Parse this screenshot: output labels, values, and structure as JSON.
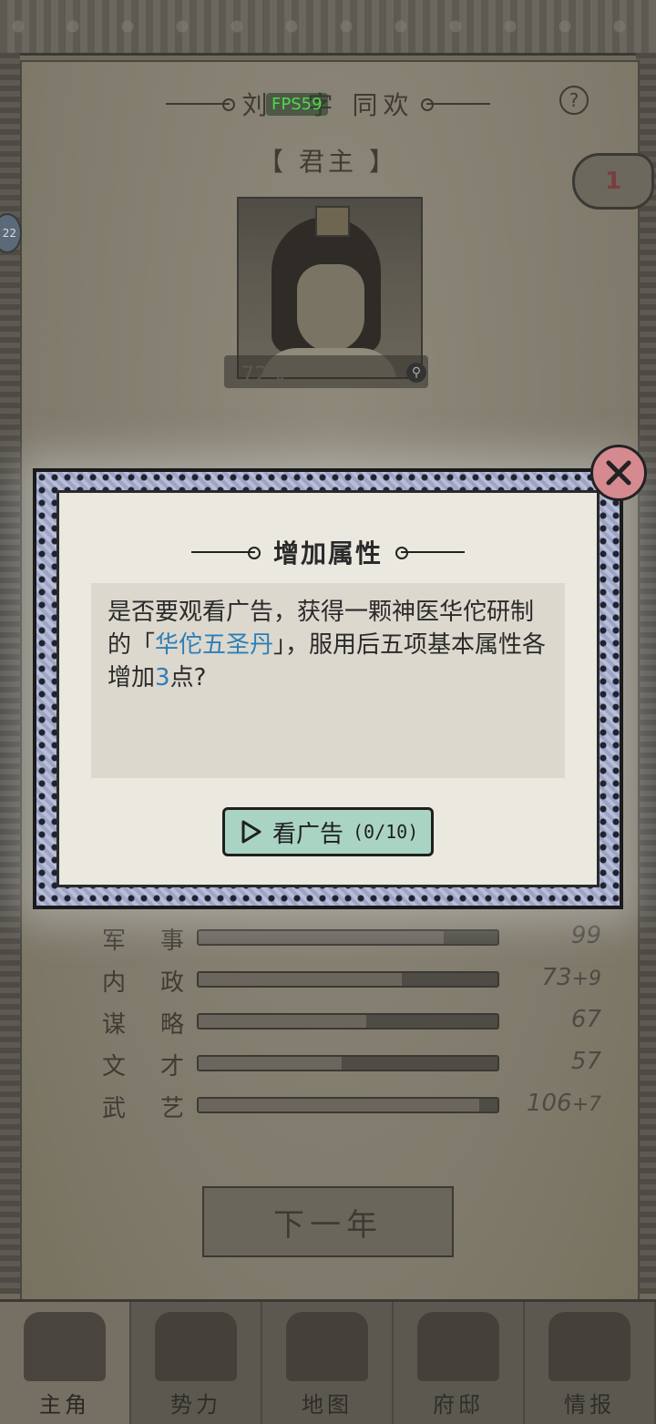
{
  "hud": {
    "character_name": "刘",
    "courtesy_name": "字 同欢",
    "fps": "FPS59",
    "help_glyph": "?",
    "role_title": "【 君主 】",
    "badge_value": "1",
    "side_tag": "22",
    "age": "72岁"
  },
  "stats": [
    {
      "label_a": "军",
      "label_b": "事",
      "value": "99",
      "bonus": "",
      "fill": 0.82
    },
    {
      "label_a": "内",
      "label_b": "政",
      "value": "73",
      "bonus": "+9",
      "fill": 0.68
    },
    {
      "label_a": "谋",
      "label_b": "略",
      "value": "67",
      "bonus": "",
      "fill": 0.56
    },
    {
      "label_a": "文",
      "label_b": "才",
      "value": "57",
      "bonus": "",
      "fill": 0.48
    },
    {
      "label_a": "武",
      "label_b": "艺",
      "value": "106",
      "bonus": "+7",
      "fill": 0.94
    }
  ],
  "next_year_label": "下一年",
  "nav": [
    {
      "label": "主角",
      "icon": "hero-icon",
      "active": true
    },
    {
      "label": "势力",
      "icon": "flag-icon",
      "active": false
    },
    {
      "label": "地图",
      "icon": "map-icon",
      "active": false
    },
    {
      "label": "府邸",
      "icon": "mansion-icon",
      "active": false
    },
    {
      "label": "情报",
      "icon": "scroll-icon",
      "active": false
    }
  ],
  "modal": {
    "title": "增加属性",
    "text_part1": "是否要观看广告，获得一颗神医华佗研制的「",
    "text_highlight": "华佗五圣丹",
    "text_part2": "」，服用后五项基本属性各增加",
    "text_number": "3",
    "text_part3": "点?",
    "button_label": "看广告",
    "button_count": "(0/10)",
    "close_icon": "close-icon"
  },
  "colors": {
    "accent_link": "#2c7fb8",
    "button_bg": "#a9d4c4",
    "close_bg": "#d58a90"
  }
}
